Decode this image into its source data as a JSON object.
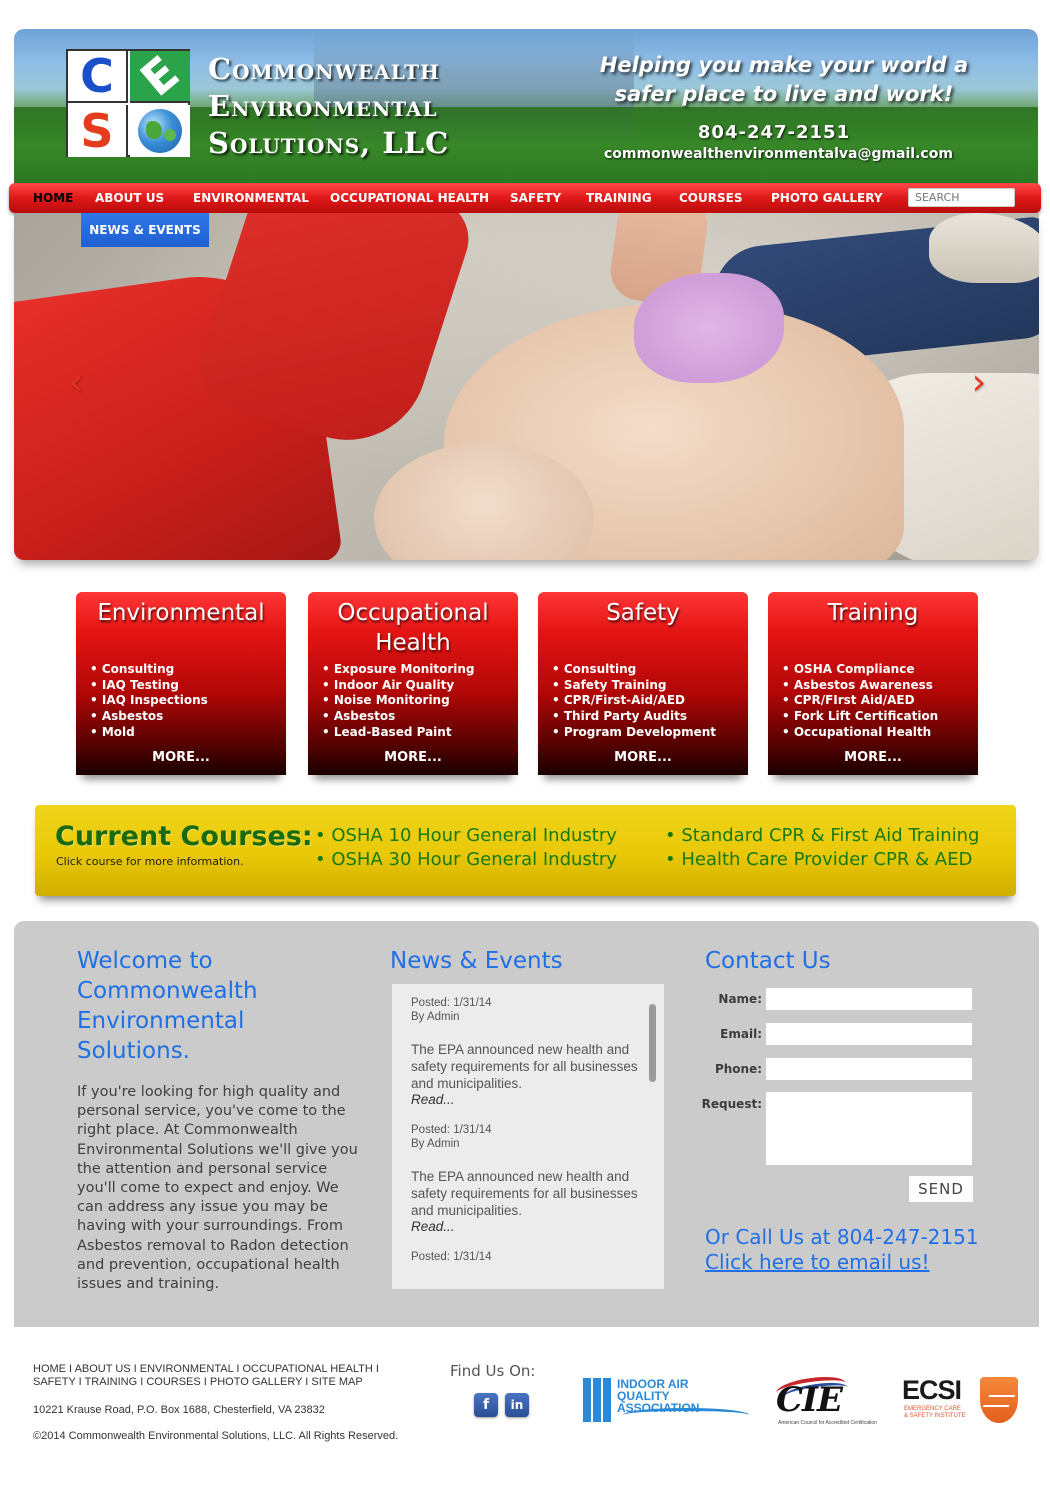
{
  "brand": {
    "logo_letters": [
      "C",
      "E",
      "S"
    ],
    "company_name_lines": [
      "Commonwealth",
      "Environmental",
      "Solutions, LLC"
    ],
    "tagline_lines": [
      "Helping you make your world a",
      "safer place to live and work!"
    ],
    "phone": "804-247-2151",
    "email": "commonwealthenvironmentalva@gmail.com",
    "colors": {
      "nav_red": "#e01818",
      "heading_blue": "#1f6fe6",
      "courses_yellow": "#e9c808",
      "courses_green": "#167a14"
    }
  },
  "nav": {
    "items": [
      "HOME",
      "ABOUT US",
      "ENVIRONMENTAL",
      "OCCUPATIONAL HEALTH",
      "SAFETY",
      "TRAINING",
      "COURSES",
      "PHOTO GALLERY"
    ],
    "active": "HOME",
    "search_placeholder": "SEARCH",
    "subnav_item": "NEWS & EVENTS"
  },
  "hero": {
    "prev_icon": "chevron-left-icon",
    "next_icon": "chevron-right-icon",
    "prev_glyph": "‹",
    "next_glyph": "›"
  },
  "services": [
    {
      "title": "Environmental",
      "items": [
        "• Consulting",
        "• IAQ Testing",
        "• IAQ Inspections",
        "• Asbestos",
        "• Mold"
      ],
      "more": "MORE..."
    },
    {
      "title": "Occupational Health",
      "items": [
        "• Exposure Monitoring",
        "• Indoor Air Quality",
        "• Noise Monitoring",
        "• Asbestos",
        "• Lead-Based Paint"
      ],
      "more": "MORE..."
    },
    {
      "title": "Safety",
      "items": [
        "• Consulting",
        "• Safety Training",
        "• CPR/First-Aid/AED",
        "• Third Party Audits",
        "• Program Development"
      ],
      "more": "MORE..."
    },
    {
      "title": "Training",
      "items": [
        "• OSHA Compliance",
        "• Asbestos Awareness",
        "• CPR/FIrst Aid/AED",
        "• Fork Lift Certification",
        "• Occupational Health"
      ],
      "more": "MORE..."
    }
  ],
  "courses": {
    "title": "Current Courses:",
    "subtitle": "Click course for more information.",
    "links": [
      "• OSHA 10 Hour General Industry",
      "• OSHA 30 Hour General Industry",
      "• Standard CPR & First Aid Training",
      "• Health Care Provider CPR & AED"
    ]
  },
  "welcome": {
    "heading_lines": [
      "Welcome to",
      "Commonwealth",
      "Environmental",
      "Solutions."
    ],
    "body": "If you're looking for high quality and personal service, you've come to the right place. At Commonwealth Environmental Solutions we'll give you the attention and personal service you'll come to expect and enjoy. We can address any issue you may be having with your surroundings. From Asbestos removal to Radon detection and prevention, occupational health issues and training."
  },
  "news": {
    "heading": "News & Events",
    "items": [
      {
        "posted": "Posted: 1/31/14",
        "author": "By Admin",
        "body": "The EPA announced new health and safety requirements for all businesses and municipalities.",
        "read": "Read..."
      },
      {
        "posted": "Posted: 1/31/14",
        "author": "By Admin",
        "body": "The EPA announced new health and safety requirements for all businesses and municipalities.",
        "read": "Read..."
      },
      {
        "posted": "Posted: 1/31/14",
        "author": "",
        "body": "",
        "read": ""
      }
    ]
  },
  "contact": {
    "heading": "Contact Us",
    "labels": {
      "name": "Name:",
      "email": "Email:",
      "phone": "Phone:",
      "request": "Request:"
    },
    "values": {
      "name": "",
      "email": "",
      "phone": "",
      "request": ""
    },
    "send": "SEND",
    "call": "Or Call Us at 804-247-2151",
    "email_link": "Click here to email us!"
  },
  "footer": {
    "nav_line1": [
      "HOME",
      "ABOUT US",
      "ENVIRONMENTAL",
      "OCCUPATIONAL HEALTH"
    ],
    "nav_line2": [
      "SAFETY",
      "TRAINING",
      "COURSES",
      "PHOTO GALLERY",
      "SITE MAP"
    ],
    "separator": " I ",
    "address": "10221 Krause Road, P.O. Box 1688, Chesterfield, VA 23832",
    "copyright": "©2014 Commonwealth Environmental Solutions, LLC. All Rights Reserved.",
    "find_us": "Find Us On:",
    "social": [
      {
        "name": "facebook-icon",
        "glyph": "f"
      },
      {
        "name": "linkedin-icon",
        "glyph": "in"
      }
    ],
    "partners": {
      "iaqa": [
        "INDOOR AIR",
        "QUALITY",
        "ASSOCIATION"
      ],
      "cie": "CIE",
      "cie_caption": "American Council for Accredited Certification",
      "ecsi": "ECSI",
      "ecsi_sub": [
        "EMERGENCY CARE",
        "& SAFETY INSTITUTE"
      ]
    }
  }
}
